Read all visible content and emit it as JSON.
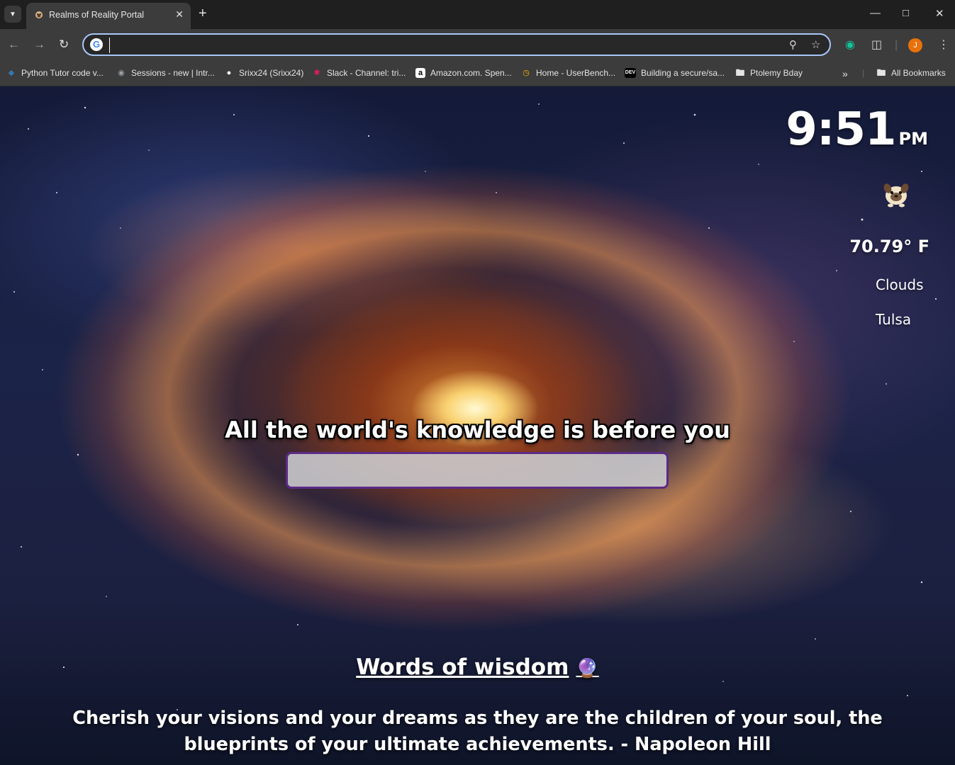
{
  "browser": {
    "tab": {
      "title": "Realms of Reality Portal",
      "favicon": "pug-favicon"
    },
    "new_tab_label": "+",
    "omnibox": {
      "value": "",
      "placeholder": ""
    },
    "profile_initial": "J",
    "bookmarks": [
      {
        "label": "Python Tutor code v...",
        "icon": "python-icon",
        "color": "#3776ab"
      },
      {
        "label": "Sessions - new | Intr...",
        "icon": "globe-icon",
        "color": "#9aa0a6"
      },
      {
        "label": "Srixx24 (Srixx24)",
        "icon": "github-icon",
        "color": "#ffffff"
      },
      {
        "label": "Slack - Channel: tri...",
        "icon": "slack-icon",
        "color": "#e01e5a"
      },
      {
        "label": "Amazon.com. Spen...",
        "icon": "amazon-icon",
        "color": "#ffffff"
      },
      {
        "label": "Home - UserBench...",
        "icon": "userbench-icon",
        "color": "#f5b400"
      },
      {
        "label": "Building a secure/sa...",
        "icon": "dev-icon",
        "color": "#000000"
      },
      {
        "label": "Ptolemy Bday",
        "icon": "folder-icon",
        "color": "#e3e3e3"
      }
    ],
    "all_bookmarks_label": "All Bookmarks"
  },
  "page": {
    "clock": {
      "time": "9:51",
      "ampm": "PM"
    },
    "weather": {
      "icon": "pug-weather-icon",
      "temperature": "70.79° F",
      "condition": "Clouds",
      "city": "Tulsa"
    },
    "headline": "All the world's knowledge is before you",
    "search": {
      "value": "",
      "placeholder": ""
    },
    "wisdom": {
      "title": "Words of wisdom",
      "emoji": "🔮",
      "quote": "Cherish your visions and your dreams as they are the children of your soul, the blueprints of your ultimate achievements. - Napoleon Hill"
    }
  }
}
